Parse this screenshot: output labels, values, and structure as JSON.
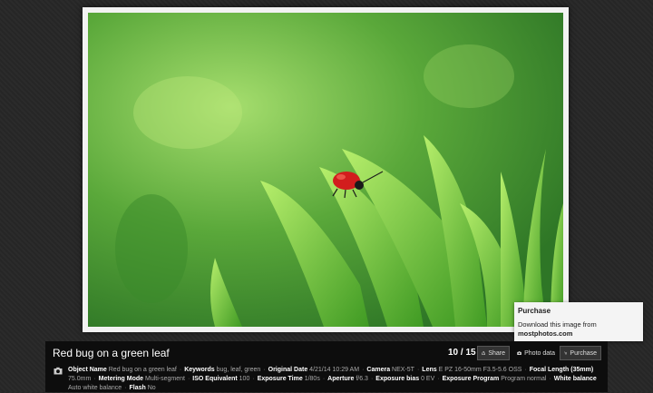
{
  "photo": {
    "title": "Red bug on a green leaf",
    "counter": "10 / 15"
  },
  "toolbar": {
    "share_label": "Share",
    "photo_data_label": "Photo data",
    "purchase_label": "Purchase"
  },
  "tooltip": {
    "title": "Purchase",
    "line": "Download this image from",
    "site": "mostphotos.com"
  },
  "metadata": [
    {
      "key": "Object Name",
      "value": "Red bug on a green leaf"
    },
    {
      "key": "Keywords",
      "value": "bug, leaf, green"
    },
    {
      "key": "Original Date",
      "value": "4/21/14 10:29 AM"
    },
    {
      "key": "Camera",
      "value": "NEX-5T"
    },
    {
      "key": "Lens",
      "value": "E PZ 16-50mm F3.5-5.6 OSS"
    },
    {
      "key": "Focal Length (35mm)",
      "value": "75.0mm"
    },
    {
      "key": "Metering Mode",
      "value": "Multi-segment"
    },
    {
      "key": "ISO Equivalent",
      "value": "100"
    },
    {
      "key": "Exposure Time",
      "value": "1/80s"
    },
    {
      "key": "Aperture",
      "value": "f/6.3"
    },
    {
      "key": "Exposure bias",
      "value": "0 EV"
    },
    {
      "key": "Exposure Program",
      "value": "Program normal"
    },
    {
      "key": "White balance",
      "value": "Auto white balance"
    },
    {
      "key": "Flash",
      "value": "No"
    }
  ],
  "icons": {
    "share": "share-icon",
    "photo_data": "camera-icon",
    "purchase": "cart-icon"
  }
}
